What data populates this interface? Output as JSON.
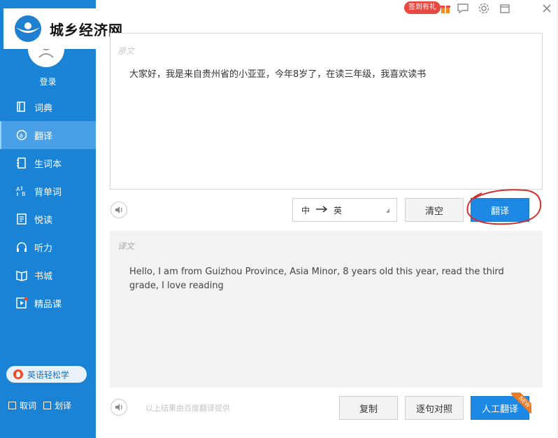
{
  "brand": {
    "name": "城乡经济网",
    "accent": "#1a83d6",
    "primary_button": "#1e88e5",
    "highlight_circle": "#d32f2f"
  },
  "header": {
    "signin_badge": "签到有礼",
    "icons": [
      "gift-icon",
      "feedback-icon",
      "settings-icon",
      "restore-icon",
      "close-icon"
    ]
  },
  "sidebar": {
    "login": "登录",
    "items": [
      {
        "label": "词典",
        "icon": "book-icon"
      },
      {
        "label": "翻译",
        "icon": "translate-icon",
        "active": true
      },
      {
        "label": "生词本",
        "icon": "notebook-icon"
      },
      {
        "label": "背单词",
        "icon": "flashcard-icon"
      },
      {
        "label": "悦读",
        "icon": "reading-icon"
      },
      {
        "label": "听力",
        "icon": "headphones-icon"
      },
      {
        "label": "书城",
        "icon": "bookstore-icon"
      },
      {
        "label": "精品课",
        "icon": "video-course-icon"
      }
    ],
    "easy_learn": "英语轻松学",
    "options": [
      {
        "label": "取词",
        "checked": false
      },
      {
        "label": "划译",
        "checked": false
      }
    ]
  },
  "input": {
    "label": "原文",
    "text": "大家好，我是来自贵州省的小亚亚，今年8岁了，在读三年级，我喜欢读书"
  },
  "toolbar": {
    "lang_from": "中",
    "lang_to": "英",
    "clear_label": "清空",
    "translate_label": "翻译"
  },
  "output": {
    "label": "译文",
    "text": "Hello, I am from Guizhou Province, Asia Minor, 8 years old this year, read the third grade, I love reading",
    "credit": "以上结果由百度翻译提供",
    "copy_label": "复制",
    "compare_label": "逐句对照",
    "human_label": "人工翻译",
    "new_tag": "NEW"
  }
}
